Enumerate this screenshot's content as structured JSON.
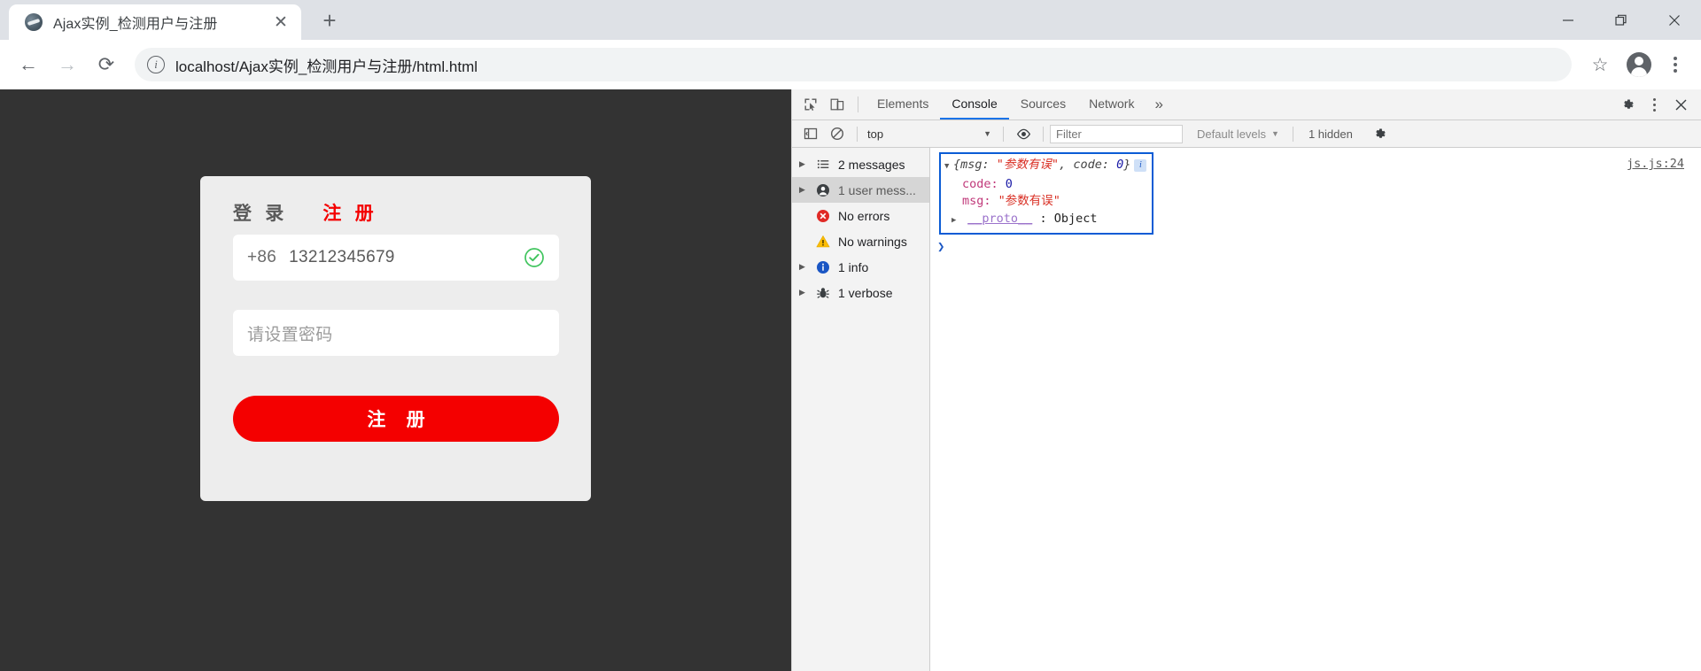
{
  "browser": {
    "tab": {
      "title": "Ajax实例_检测用户与注册",
      "close_label": "✕",
      "favicon": "globe-icon"
    },
    "newtab_label": "+",
    "window": {
      "minimize": "—",
      "maximize": "❐",
      "close": "✕"
    },
    "toolbar": {
      "back": "←",
      "forward": "→",
      "reload": "⟳",
      "info_label": "i",
      "url": "localhost/Ajax实例_检测用户与注册/html.html",
      "bookmark": "☆"
    }
  },
  "page": {
    "card": {
      "tabs": [
        {
          "label": "登 录",
          "active": false
        },
        {
          "label": "注 册",
          "active": true
        }
      ],
      "phone_field": {
        "country_code": "+86",
        "value": "13212345679",
        "valid_icon": "check-circle-icon"
      },
      "password_field": {
        "placeholder": "请设置密码",
        "value": ""
      },
      "submit_label": "注 册",
      "accent_color": "#f40000",
      "card_bg": "#ededed",
      "page_bg": "#333333"
    }
  },
  "devtools": {
    "tabs": [
      {
        "label": "Elements",
        "active": false
      },
      {
        "label": "Console",
        "active": true
      },
      {
        "label": "Sources",
        "active": false
      },
      {
        "label": "Network",
        "active": false
      }
    ],
    "more_label": "»",
    "icons": {
      "inspect": "inspect-element-icon",
      "device": "device-toolbar-icon",
      "settings": "gear-icon",
      "menu": "kebab-menu-icon",
      "close": "close-icon",
      "sidebar_toggle": "show-console-sidebar-icon",
      "clear": "clear-console-icon",
      "eye": "live-expression-icon"
    },
    "filterbar": {
      "context": "top",
      "context_caret": "▼",
      "filter_placeholder": "Filter",
      "levels_label": "Default levels",
      "levels_caret": "▼",
      "hidden_label": "1 hidden"
    },
    "sidebar": [
      {
        "label": "2 messages",
        "icon": "list-icon",
        "expandable": true,
        "selected": false
      },
      {
        "label": "1 user mess...",
        "icon": "user-icon",
        "expandable": true,
        "selected": true
      },
      {
        "label": "No errors",
        "icon": "error-icon",
        "expandable": false,
        "selected": false
      },
      {
        "label": "No warnings",
        "icon": "warning-icon",
        "expandable": false,
        "selected": false
      },
      {
        "label": "1 info",
        "icon": "info-icon",
        "expandable": true,
        "selected": false
      },
      {
        "label": "1 verbose",
        "icon": "bug-icon",
        "expandable": true,
        "selected": false
      }
    ],
    "console": {
      "source_link": "js.js:24",
      "prompt": "❯",
      "message": {
        "collapse_arrow": "▼",
        "summary_open": "{",
        "summary_key1": "msg:",
        "summary_val1": "\"参数有误\"",
        "summary_comma": ",",
        "summary_key2": "code:",
        "summary_val2": "0",
        "summary_close": "}",
        "info_badge": "i",
        "props": [
          {
            "key": "code:",
            "value": "0",
            "type": "number"
          },
          {
            "key": "msg:",
            "value": "\"参数有误\"",
            "type": "string"
          }
        ],
        "proto_arrow": "▶",
        "proto_key": "__proto__",
        "proto_sep": ":",
        "proto_value": "Object"
      }
    }
  }
}
